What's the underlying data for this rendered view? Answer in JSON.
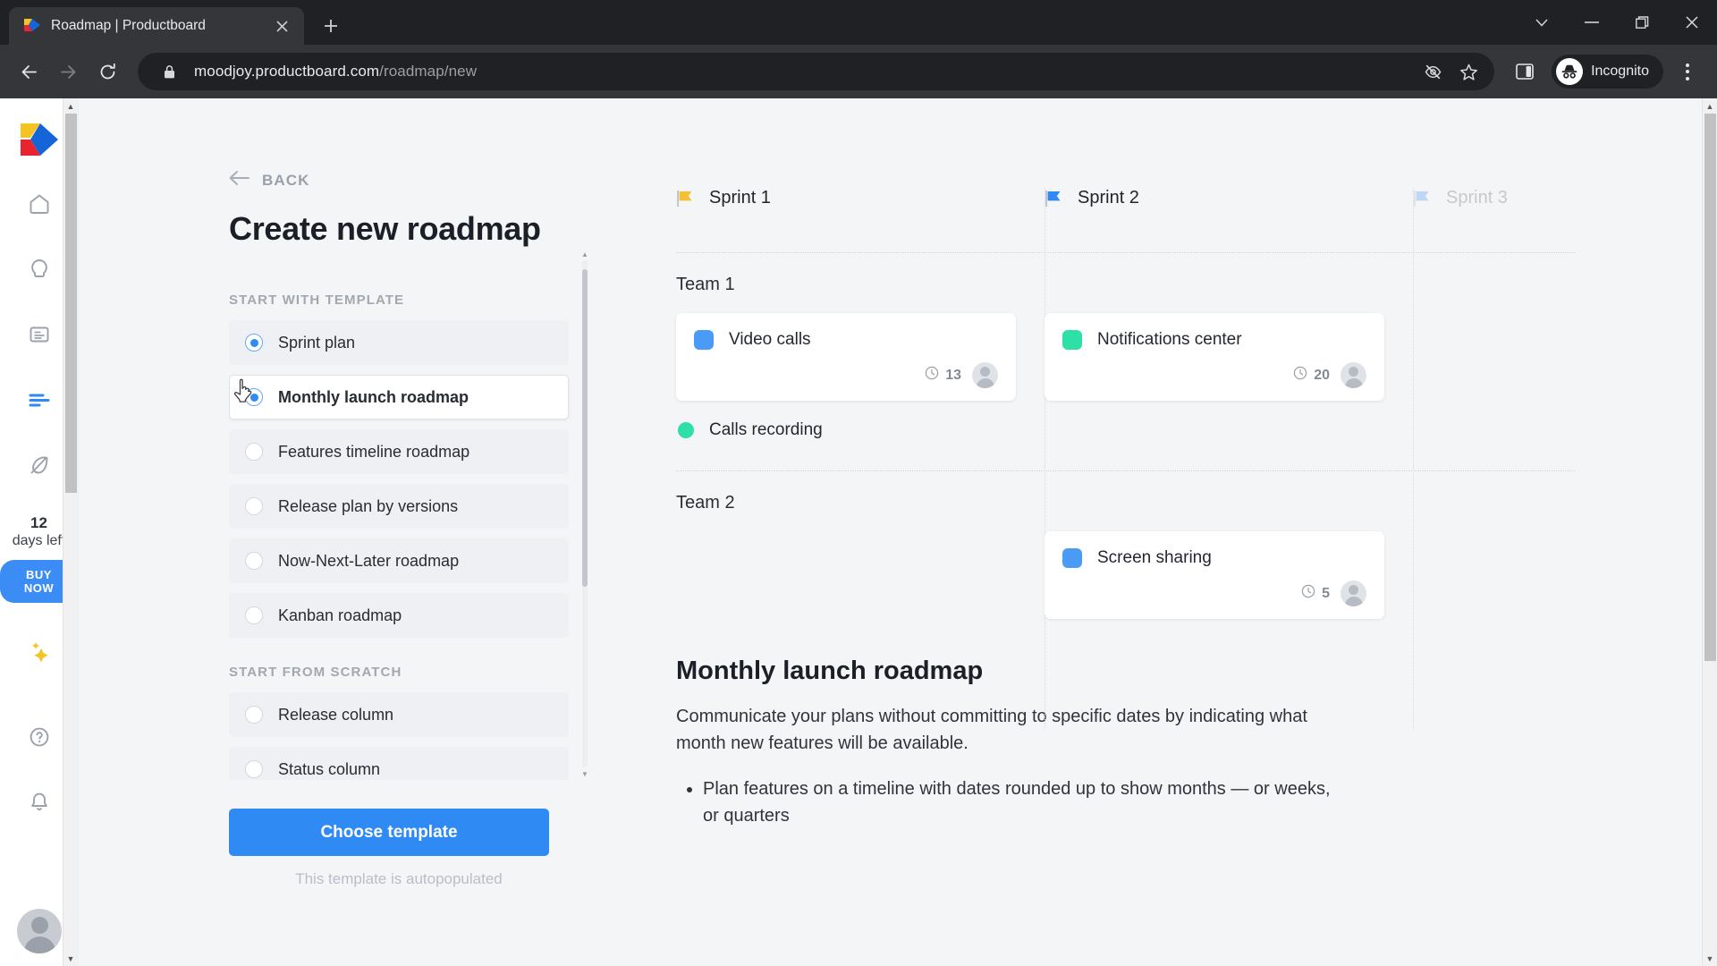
{
  "browser": {
    "tab": {
      "title": "Roadmap | Productboard",
      "favicon": "productboard-logo-icon",
      "close_icon": "close-icon"
    },
    "new_tab_icon": "plus-icon",
    "window_controls": [
      {
        "name": "tab-search-button",
        "icon": "chevron-down-icon",
        "glyph": "⌄"
      },
      {
        "name": "minimize-button",
        "icon": "minimize-icon",
        "glyph": "—"
      },
      {
        "name": "maximize-button",
        "icon": "maximize-icon",
        "glyph": "❐"
      },
      {
        "name": "close-window-button",
        "icon": "close-icon",
        "glyph": "✕"
      }
    ],
    "nav": {
      "back_icon": "arrow-left-icon",
      "forward_icon": "arrow-right-icon",
      "reload_icon": "reload-icon"
    },
    "omnibox": {
      "lock_icon": "lock-icon",
      "domain": "moodjoy.productboard.com",
      "path": "/roadmap/new",
      "tracking_icon": "eye-slash-icon",
      "bookmark_icon": "star-icon"
    },
    "side_panel_icon": "side-panel-icon",
    "incognito": {
      "label": "Incognito",
      "icon": "incognito-icon"
    },
    "menu_icon": "kebab-menu-icon"
  },
  "rail": {
    "logo": "productboard-logo",
    "items": [
      {
        "name": "home",
        "icon": "home-icon"
      },
      {
        "name": "insights",
        "icon": "lightbulb-icon"
      },
      {
        "name": "features",
        "icon": "document-icon"
      },
      {
        "name": "roadmap",
        "icon": "roadmap-lines-icon",
        "active": true
      },
      {
        "name": "objectives",
        "icon": "objectives-icon"
      }
    ],
    "trial": {
      "days": "12",
      "days_label": "days left",
      "buy_label": "BUY NOW"
    },
    "sparkle_icon": "sparkle-icon",
    "help_icon": "help-circle-icon",
    "bell_icon": "bell-icon",
    "avatar": "user-avatar"
  },
  "panel": {
    "back_label": "BACK",
    "back_icon": "arrow-left-icon",
    "title": "Create new roadmap",
    "template_section_label": "START WITH TEMPLATE",
    "templates": [
      {
        "label": "Sprint plan",
        "selected": true,
        "hovered": false
      },
      {
        "label": "Monthly launch roadmap",
        "selected": true,
        "hovered": true
      },
      {
        "label": "Features timeline roadmap",
        "selected": false,
        "hovered": false
      },
      {
        "label": "Release plan by versions",
        "selected": false,
        "hovered": false
      },
      {
        "label": "Now-Next-Later roadmap",
        "selected": false,
        "hovered": false
      },
      {
        "label": "Kanban roadmap",
        "selected": false,
        "hovered": false
      }
    ],
    "scratch_section_label": "START FROM SCRATCH",
    "scratch_options": [
      {
        "label": "Release column",
        "selected": false
      },
      {
        "label": "Status column",
        "selected": false
      }
    ],
    "choose_button_label": "Choose template",
    "autopopulate_note": "This template is autopopulated"
  },
  "preview": {
    "columns": [
      {
        "label": "Sprint 1",
        "flag_color": "#f5c033",
        "faded": false
      },
      {
        "label": "Sprint 2",
        "flag_color": "#2f8bf3",
        "faded": false
      },
      {
        "label": "Sprint 3",
        "flag_color": "#7db4f2",
        "faded": true
      }
    ],
    "rows": [
      {
        "team": "Team 1",
        "cards": [
          {
            "column": 0,
            "title": "Video calls",
            "color": "#4a9bf5",
            "estimate": "13",
            "avatar": "user-avatar",
            "clock_icon": "clock-icon"
          },
          {
            "column": 1,
            "title": "Notifications center",
            "color": "#2ee0a5",
            "estimate": "20",
            "avatar": "user-avatar",
            "clock_icon": "clock-icon"
          }
        ],
        "subitems": [
          {
            "column": 0,
            "label": "Calls recording",
            "color": "#2ee0a5"
          }
        ]
      },
      {
        "team": "Team 2",
        "cards": [
          {
            "column": 1,
            "title": "Screen sharing",
            "color": "#4a9bf5",
            "estimate": "5",
            "avatar": "user-avatar",
            "clock_icon": "clock-icon"
          }
        ],
        "subitems": []
      }
    ],
    "description": {
      "title": "Monthly launch roadmap",
      "paragraph": "Communicate your plans without committing to specific dates by indicating what month new features will be available.",
      "bullets": [
        "Plan features on a timeline with dates rounded up to show months — or weeks, or quarters"
      ]
    }
  },
  "colors": {
    "accent": "#2f8bf3",
    "page_bg": "#f4f5f7",
    "chrome_bg": "#202124",
    "toolbar_bg": "#35363a"
  }
}
